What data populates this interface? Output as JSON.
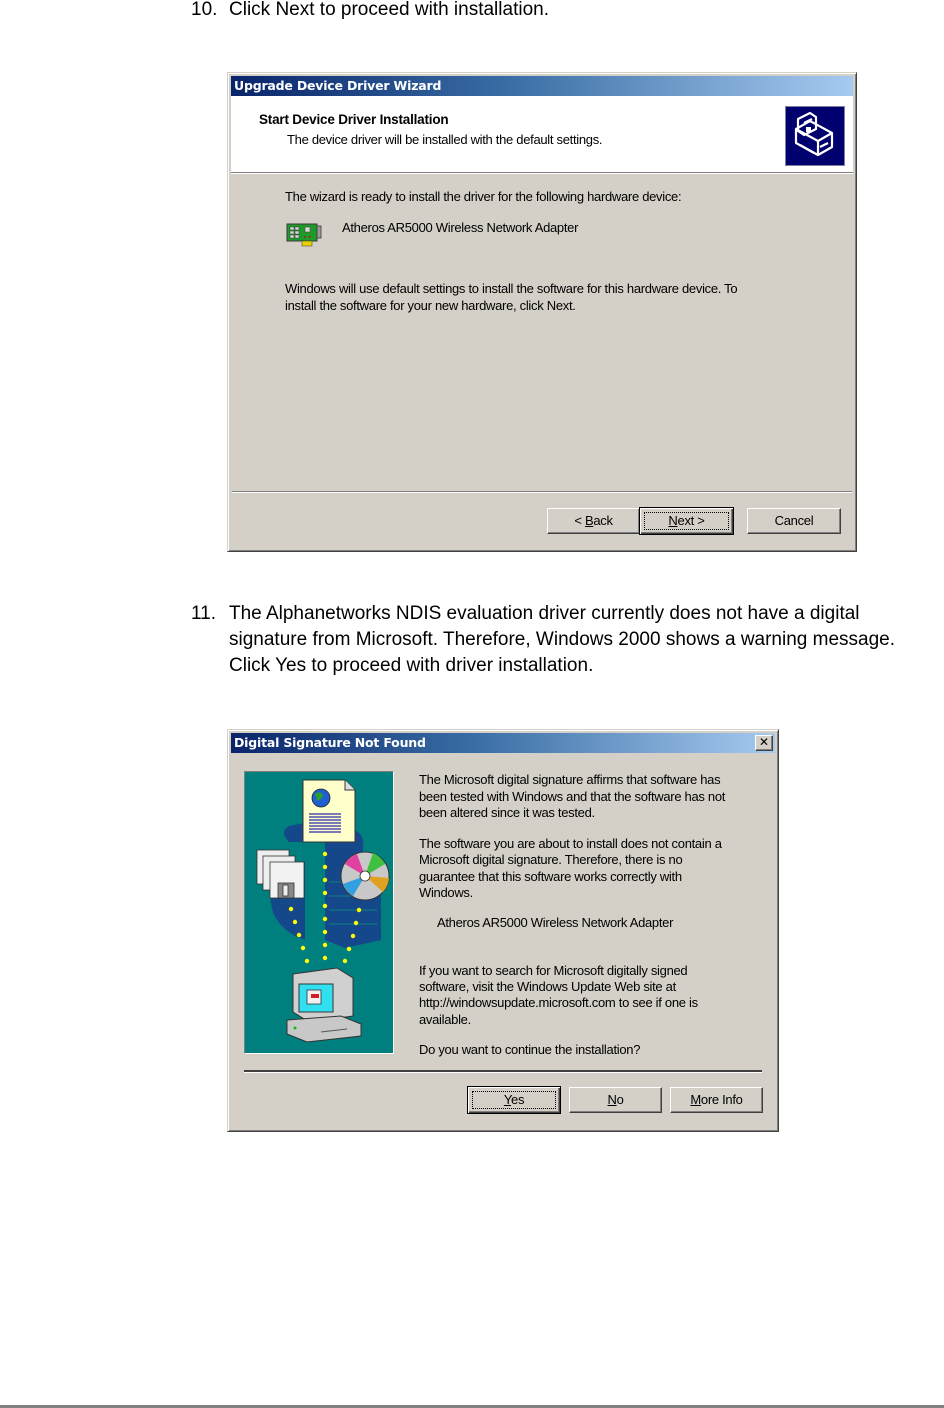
{
  "steps": [
    {
      "number": "10.",
      "text": "Click Next to proceed with installation."
    },
    {
      "number": "11.",
      "text": "The Alphanetworks NDIS evaluation driver currently does not have a digital signature from Microsoft. Therefore, Windows 2000 shows a warning message. Click Yes to proceed with driver installation."
    }
  ],
  "wizard": {
    "title": "Upgrade Device Driver Wizard",
    "header_title": "Start Device Driver Installation",
    "header_subtitle": "The device driver will be installed with the default settings.",
    "header_icon": "hardware-install-icon",
    "ready_text": "The wizard is ready to install the driver for the following hardware device:",
    "device_icon": "network-card-icon",
    "device_name": "Atheros AR5000 Wireless Network Adapter",
    "info_line1": "Windows will use default settings to install the software for this hardware device. To",
    "info_line2": "install the software for your new hardware, click Next.",
    "buttons": {
      "back": {
        "prefix": "< ",
        "mnemonic": "B",
        "rest": "ack"
      },
      "next": {
        "mnemonic": "N",
        "rest": "ext >"
      },
      "cancel": "Cancel"
    },
    "default_button": "next"
  },
  "signature_dialog": {
    "title": "Digital Signature Not Found",
    "close_glyph": "✕",
    "illustration": "software-install-illustration",
    "para1": [
      "The Microsoft digital signature affirms that software has",
      "been tested with Windows and that the software has not",
      "been altered since it was tested."
    ],
    "para2": [
      "The software you are about to install does not contain a",
      "Microsoft digital signature. Therefore,  there is no",
      "guarantee that this software works correctly with",
      "Windows."
    ],
    "device_name": "Atheros AR5000 Wireless Network Adapter",
    "para3": [
      "If you want to search for Microsoft digitally signed",
      "software, visit the Windows Update Web site at",
      "http://windowsupdate.microsoft.com to see if one is",
      "available."
    ],
    "question": "Do you want to continue the installation?",
    "buttons": {
      "yes": {
        "mnemonic": "Y",
        "rest": "es"
      },
      "no": {
        "mnemonic": "N",
        "rest": "o"
      },
      "more_info": {
        "mnemonic": "M",
        "rest": "ore Info"
      }
    },
    "default_button": "yes"
  },
  "colors": {
    "titlebar_start": "#0a246a",
    "titlebar_end": "#a6caf0",
    "dialog_face": "#d4d0c8",
    "illustration_bg": "#007f7f",
    "header_icon_bg": "#00006e"
  }
}
